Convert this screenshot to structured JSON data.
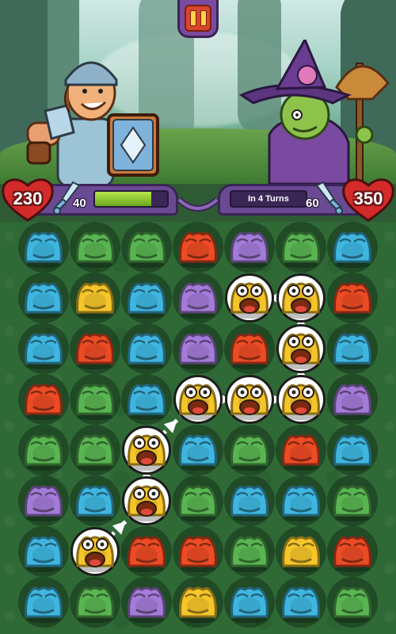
{
  "player": {
    "health": "230",
    "attack": "40",
    "charge_fraction": 0.78
  },
  "enemy": {
    "health": "350",
    "attack": "60",
    "turns_label": "In 4 Turns"
  },
  "colors": {
    "blue": "#3fb6e0",
    "green": "#59b552",
    "red": "#ec4b24",
    "purple": "#a37bd8",
    "yellow": "#f5c52a",
    "heart": "#d32a2a",
    "panel": "#6a4a93"
  },
  "icons": {
    "pause": "pause-icon",
    "heart": "heart-icon",
    "sword": "sword-icon"
  },
  "board": {
    "columns": 7,
    "rows": 8,
    "grid": [
      [
        "blue",
        "green",
        "green",
        "red",
        "purple",
        "green",
        "blue"
      ],
      [
        "blue",
        "yellow",
        "blue",
        "purple",
        "yellow",
        "yellow",
        "red"
      ],
      [
        "blue",
        "red",
        "blue",
        "purple",
        "red",
        "yellow",
        "blue"
      ],
      [
        "red",
        "green",
        "blue",
        "yellow",
        "yellow",
        "yellow",
        "purple"
      ],
      [
        "green",
        "green",
        "yellow",
        "blue",
        "green",
        "red",
        "blue"
      ],
      [
        "purple",
        "blue",
        "yellow",
        "green",
        "blue",
        "blue",
        "green"
      ],
      [
        "blue",
        "yellow",
        "red",
        "red",
        "green",
        "yellow",
        "red"
      ],
      [
        "blue",
        "green",
        "purple",
        "yellow",
        "blue",
        "blue",
        "green"
      ]
    ],
    "selected_chain": [
      [
        6,
        1
      ],
      [
        5,
        2
      ],
      [
        4,
        2
      ],
      [
        3,
        3
      ],
      [
        3,
        4
      ],
      [
        3,
        5
      ],
      [
        2,
        5
      ],
      [
        1,
        5
      ],
      [
        1,
        4
      ]
    ]
  }
}
